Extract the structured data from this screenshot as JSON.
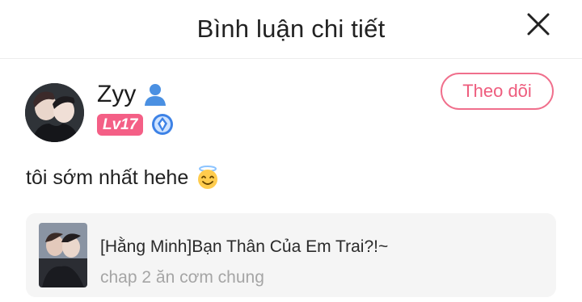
{
  "header": {
    "title": "Bình luận chi tiết",
    "close_icon": "close-icon"
  },
  "author": {
    "username": "Zyy",
    "level": "Lv17",
    "follow_label": "Theo dõi"
  },
  "comment": {
    "text": "tôi sớm nhất hehe",
    "emoji": "smiling-face-with-halo"
  },
  "book": {
    "title": "[Hằng Minh]Bạn Thân Của Em Trai?!~",
    "chapter": "chap 2 ăn cơm chung"
  },
  "colors": {
    "accent": "#f06f8c",
    "level_badge": "#f45f86",
    "vip_blue": "#3d82e6"
  }
}
